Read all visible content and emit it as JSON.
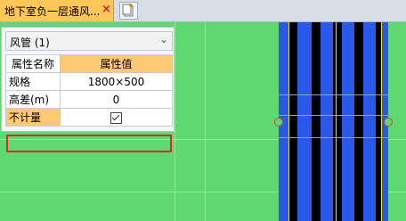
{
  "tabs": [
    {
      "label": "地下室负一层通风...",
      "close": "×",
      "icon": "close-icon"
    }
  ],
  "new_tab_icon": "new-document-icon",
  "panel": {
    "category_selected": "风管 (1)",
    "chevron_icon": "chevron-down-icon",
    "table": {
      "headers": [
        "属性名称",
        "属性值"
      ],
      "rows": [
        {
          "name": "规格",
          "value": "1800×500"
        },
        {
          "name": "高差(m)",
          "value": "0"
        },
        {
          "name": "不计量",
          "value": "",
          "checked": true
        }
      ]
    }
  },
  "colors": {
    "canvas": "#5fd86f",
    "tab_active": "#ffc75a",
    "header_accent": "#ffc873",
    "duct_blue": "#2a58e8",
    "highlight": "#e8232a"
  }
}
